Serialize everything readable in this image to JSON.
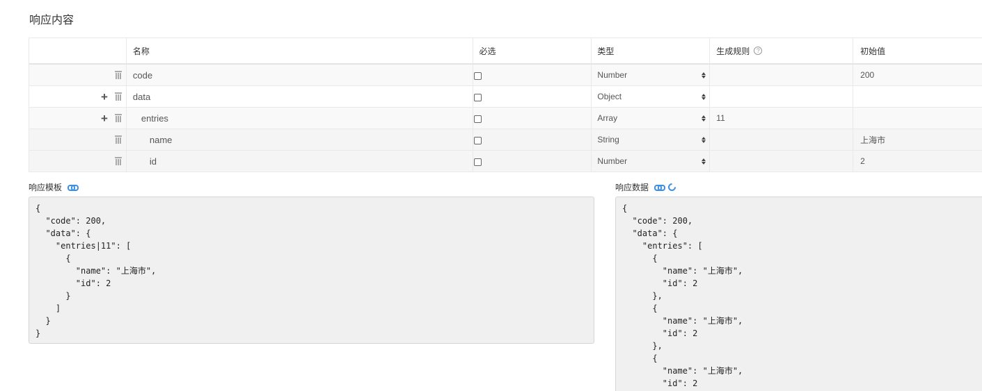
{
  "section_title": "响应内容",
  "table": {
    "headers": {
      "name": "名称",
      "required": "必选",
      "type": "类型",
      "rule": "生成规则",
      "initial": "初始值"
    },
    "help_icon": "?",
    "rows": [
      {
        "name": "code",
        "type": "Number",
        "rule": "",
        "initial": "200",
        "required": false
      },
      {
        "name": "data",
        "type": "Object",
        "rule": "",
        "initial": "",
        "required": false
      },
      {
        "name": "entries",
        "type": "Array",
        "rule": "11",
        "initial": "",
        "required": false
      },
      {
        "name": "name",
        "type": "String",
        "rule": "",
        "initial": "上海市",
        "required": false
      },
      {
        "name": "id",
        "type": "Number",
        "rule": "",
        "initial": "2",
        "required": false
      }
    ],
    "add_symbol": "+"
  },
  "template_panel": {
    "label": "响应模板",
    "code": "{\n  \"code\": 200,\n  \"data\": {\n    \"entries|11\": [\n      {\n        \"name\": \"上海市\",\n        \"id\": 2\n      }\n    ]\n  }\n}"
  },
  "data_panel": {
    "label": "响应数据",
    "code": "{\n  \"code\": 200,\n  \"data\": {\n    \"entries\": [\n      {\n        \"name\": \"上海市\",\n        \"id\": 2\n      },\n      {\n        \"name\": \"上海市\",\n        \"id\": 2\n      },\n      {\n        \"name\": \"上海市\",\n        \"id\": 2"
  },
  "icons": {
    "delete": "trash-icon",
    "add": "plus-icon",
    "link": "link-icon",
    "refresh": "refresh-icon",
    "help": "question-circle-icon"
  },
  "colors": {
    "accent": "#3a8ee6",
    "code_bg": "#f0f0f0"
  }
}
